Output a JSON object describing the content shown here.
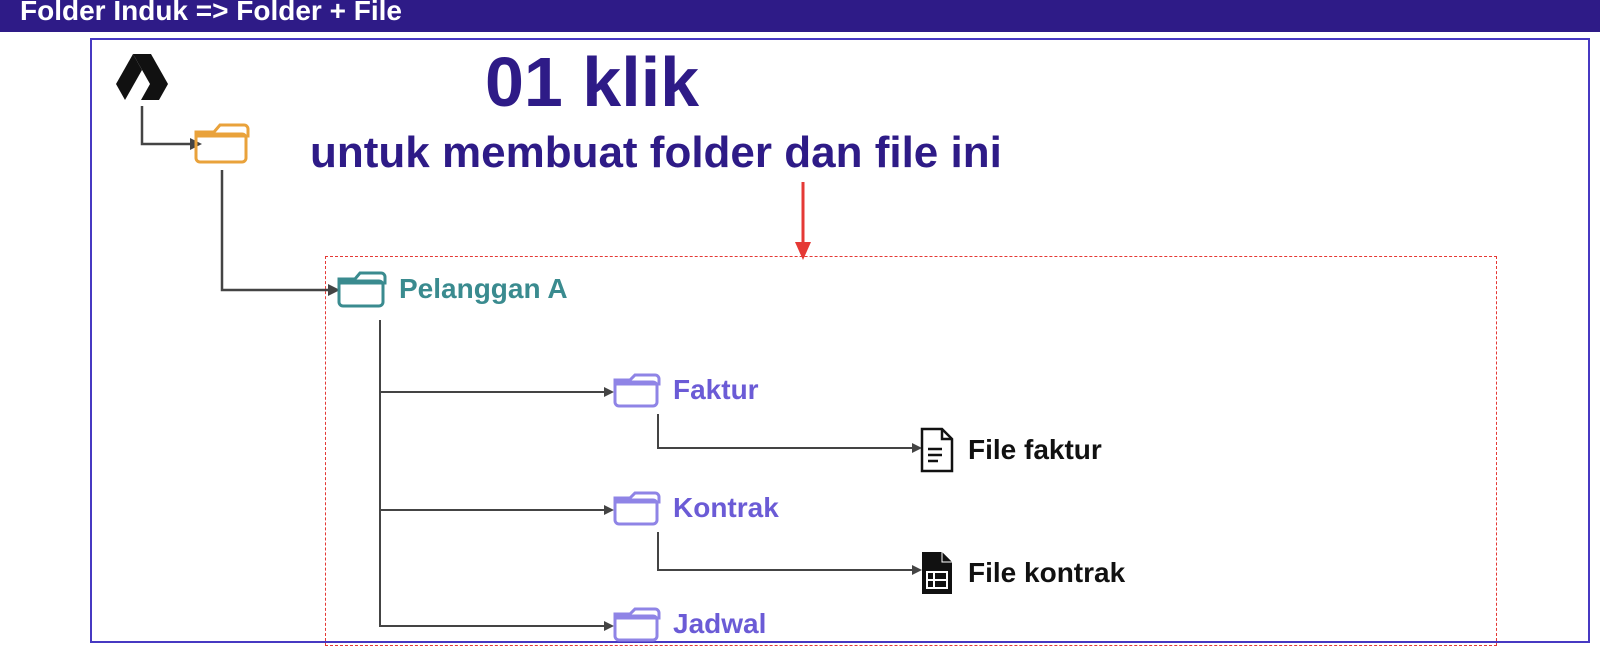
{
  "banner": {
    "title": "Folder Induk => Folder + File"
  },
  "headline": {
    "big": "01 klik",
    "sub": "untuk membuat folder dan file ini"
  },
  "tree": {
    "drive_icon": "google-drive",
    "root_folder": {
      "label": ""
    },
    "customer": {
      "label": "Pelanggan A"
    },
    "subfolders": [
      {
        "label": "Faktur",
        "file": {
          "label": "File faktur",
          "icon": "doc"
        }
      },
      {
        "label": "Kontrak",
        "file": {
          "label": "File kontrak",
          "icon": "sheet-solid"
        }
      },
      {
        "label": "Jadwal",
        "file": null
      }
    ]
  },
  "colors": {
    "banner_bg": "#2e1b87",
    "frame": "#4739c2",
    "dashed": "#e53935",
    "folder_orange": "#e9a23b",
    "folder_teal": "#3a8b8f",
    "folder_purple": "#8f84e6",
    "text_purple": "#6b5bd6",
    "arrow_red": "#e53935"
  }
}
